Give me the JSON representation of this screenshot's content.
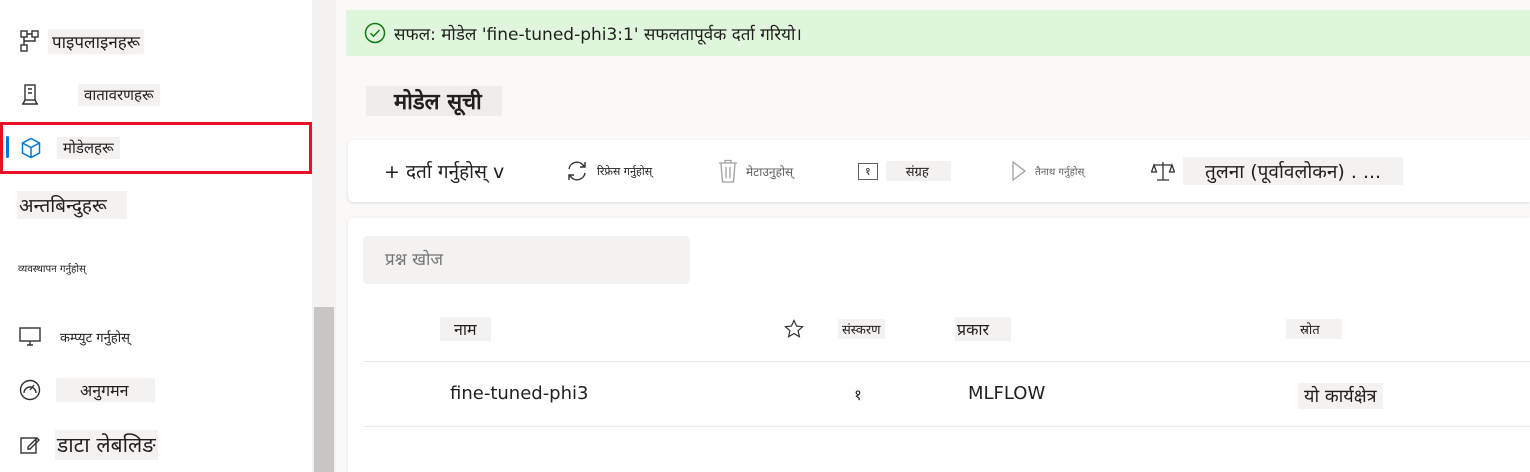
{
  "sidebar": {
    "items": [
      {
        "id": "pipelines",
        "label": "पाइपलाइनहरू",
        "icon": "pipeline-icon"
      },
      {
        "id": "environments",
        "label": "वातावरणहरू",
        "icon": "environment-icon"
      },
      {
        "id": "models",
        "label": "मोडेलहरू",
        "icon": "cube-icon",
        "selected": true
      },
      {
        "id": "endpoints",
        "label": "अन्तबिन्दुहरू",
        "icon": ""
      },
      {
        "id": "manage",
        "label": "व्यवस्थापन गर्नुहोस्",
        "icon": ""
      },
      {
        "id": "compute",
        "label": "कम्प्युट गर्नुहोस्",
        "icon": "computer-icon"
      },
      {
        "id": "monitoring",
        "label": "अनुगमन",
        "icon": "gauge-icon"
      },
      {
        "id": "data-labeling",
        "label": "डाटा लेबलिङ",
        "icon": "edit-icon"
      }
    ]
  },
  "banner": {
    "message": "सफल: मोडेल 'fine-tuned-phi3:1' सफलतापूर्वक दर्ता गरियो।",
    "status_color": "#107c10"
  },
  "page": {
    "title": "मोडेल सूची"
  },
  "toolbar": {
    "register": "+ दर्ता गर्नुहोस् v",
    "refresh": "रिफ्रेस गर्नुहोस्",
    "delete": "मेटाउनुहोस्",
    "archive_count": "१",
    "archive": "संग्रह",
    "deploy": "तैनाथ गर्नुहोस्",
    "compare": "तुलना (पूर्वावलोकन) . ..."
  },
  "search": {
    "placeholder": "प्रश्न खोज"
  },
  "table": {
    "headers": {
      "name": "नाम",
      "version": "संस्करण",
      "type": "प्रकार",
      "source": "स्रोत"
    },
    "rows": [
      {
        "name": "fine-tuned-phi3",
        "version": "१",
        "type": "MLFLOW",
        "source": "यो कार्यक्षेत्र"
      }
    ]
  },
  "colors": {
    "accent": "#0078d4",
    "selection_border": "#e81123",
    "success_bg": "#dff6dd"
  }
}
